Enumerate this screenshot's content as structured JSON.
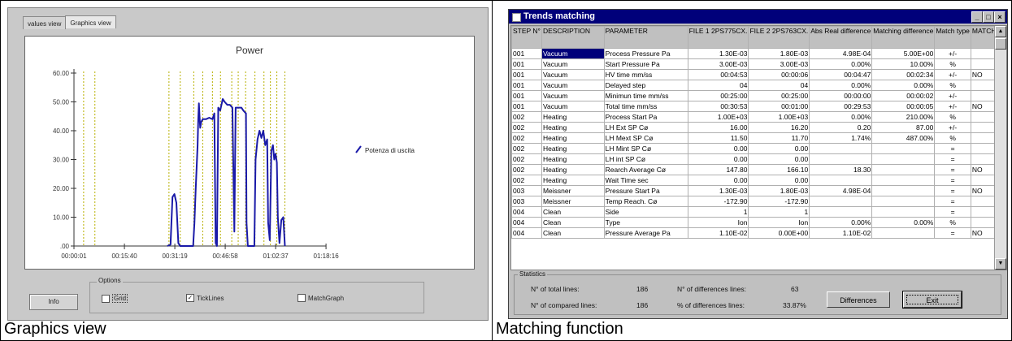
{
  "left": {
    "caption": "Graphics view",
    "tabs": [
      "values view",
      "Graphics view"
    ],
    "options_label": "Options",
    "opt_grid": "Grid",
    "opt_ticklines": "TickLines",
    "opt_matchgraph": "MatchGraph",
    "info_label": "Info"
  },
  "chart_data": {
    "type": "line",
    "title": "Power",
    "xlabel": "",
    "ylabel": "",
    "ylim": [
      0,
      60
    ],
    "y_ticks": [
      "60.00",
      "50.00",
      "40.00",
      "30.00",
      "20.00",
      "10.00",
      ".00"
    ],
    "x_ticks": [
      "00:00:01",
      "00:15:40",
      "00:31:19",
      "00:46:58",
      "01:02:37",
      "01:18:16"
    ],
    "x_range_minutes": [
      0,
      78.25
    ],
    "legend": "top-right",
    "series": [
      {
        "name": "Potenza di uscita",
        "color": "#1a1aa8",
        "points": [
          [
            29.0,
            0
          ],
          [
            30.0,
            0.5
          ],
          [
            30.6,
            17
          ],
          [
            31.2,
            18
          ],
          [
            31.8,
            15
          ],
          [
            32.4,
            1
          ],
          [
            33.0,
            0
          ],
          [
            37.0,
            0
          ],
          [
            37.4,
            8
          ],
          [
            37.8,
            20
          ],
          [
            38.4,
            35
          ],
          [
            38.6,
            44
          ],
          [
            38.8,
            49.5
          ],
          [
            39.0,
            45
          ],
          [
            39.2,
            41
          ],
          [
            39.5,
            43
          ],
          [
            40.0,
            44
          ],
          [
            41.0,
            44
          ],
          [
            42.0,
            44.5
          ],
          [
            43.0,
            44
          ],
          [
            43.6,
            46
          ],
          [
            44.0,
            1
          ],
          [
            44.4,
            0
          ],
          [
            44.8,
            48
          ],
          [
            45.4,
            47
          ],
          [
            46.2,
            51
          ],
          [
            46.8,
            50
          ],
          [
            47.6,
            49
          ],
          [
            48.4,
            49
          ],
          [
            49.2,
            48
          ],
          [
            49.8,
            5
          ],
          [
            50.2,
            48
          ],
          [
            52.0,
            48
          ],
          [
            52.6,
            47
          ],
          [
            53.4,
            46
          ],
          [
            53.6,
            8
          ],
          [
            54.0,
            0
          ],
          [
            56.0,
            0
          ],
          [
            56.4,
            30
          ],
          [
            57.0,
            37
          ],
          [
            57.6,
            40
          ],
          [
            58.2,
            37.5
          ],
          [
            58.8,
            40
          ],
          [
            59.4,
            35
          ],
          [
            60.0,
            37
          ],
          [
            60.3,
            8
          ],
          [
            60.8,
            2
          ],
          [
            61.3,
            33
          ],
          [
            61.8,
            35
          ],
          [
            62.2,
            30
          ],
          [
            62.6,
            32
          ],
          [
            63.0,
            29
          ],
          [
            63.3,
            10
          ],
          [
            63.8,
            1
          ],
          [
            64.4,
            9
          ],
          [
            65.0,
            10
          ],
          [
            65.5,
            0
          ]
        ]
      }
    ],
    "tick_lines_minutes": [
      3.0,
      6.5,
      29.5,
      33.0,
      37.2,
      40.0,
      43.0,
      45.5,
      49.0,
      51.0,
      53.3,
      56.2,
      59.0,
      61.0,
      63.0,
      65.5
    ]
  },
  "right": {
    "caption": "Matching function",
    "window_title": "Trends matching",
    "columns": [
      "STEP N°",
      "DESCRIPTION",
      "PARAMETER",
      "FILE 1 2PS775CX.",
      "FILE 2 2PS763CX.",
      "Abs Real difference",
      "Matching difference",
      "Match type",
      "MATCH?"
    ],
    "rows": [
      [
        "001",
        "Vacuum",
        "Process Pressure Pa",
        "1.30E-03",
        "1.80E-03",
        "4.98E-04",
        "5.00E+00",
        "+/-",
        ""
      ],
      [
        "001",
        "Vacuum",
        "Start Pressure Pa",
        "3.00E-03",
        "3.00E-03",
        "0.00%",
        "10.00%",
        "%",
        ""
      ],
      [
        "001",
        "Vacuum",
        "HV time mm/ss",
        "00:04:53",
        "00:00:06",
        "00:04:47",
        "00:02:34",
        "+/-",
        "NO"
      ],
      [
        "001",
        "Vacuum",
        "Delayed step",
        "04",
        "04",
        "0.00%",
        "0.00%",
        "%",
        ""
      ],
      [
        "001",
        "Vacuum",
        "Minimun time mm/ss",
        "00:25:00",
        "00:25:00",
        "00:00:00",
        "00:00:02",
        "+/-",
        ""
      ],
      [
        "001",
        "Vacuum",
        "Total time mm/ss",
        "00:30:53",
        "00:01:00",
        "00:29:53",
        "00:00:05",
        "+/-",
        "NO"
      ],
      [
        "002",
        "Heating",
        "Process Start Pa",
        "1.00E+03",
        "1.00E+03",
        "0.00%",
        "210.00%",
        "%",
        ""
      ],
      [
        "002",
        "Heating",
        "LH Ext SP Cø",
        "16.00",
        "16.20",
        "0.20",
        "87.00",
        "+/-",
        ""
      ],
      [
        "002",
        "Heating",
        "LH Mext SP Cø",
        "11.50",
        "11.70",
        "1.74%",
        "487.00%",
        "%",
        ""
      ],
      [
        "002",
        "Heating",
        "LH Mint SP Cø",
        "0.00",
        "0.00",
        "",
        "",
        "=",
        ""
      ],
      [
        "002",
        "Heating",
        "LH int SP Cø",
        "0.00",
        "0.00",
        "",
        "",
        "=",
        ""
      ],
      [
        "002",
        "Heating",
        "Rearch Average Cø",
        "147.80",
        "166.10",
        "18.30",
        "",
        "=",
        "NO"
      ],
      [
        "002",
        "Heating",
        "Wait Time sec",
        "0.00",
        "0.00",
        "",
        "",
        "=",
        ""
      ],
      [
        "003",
        "Meissner",
        "Pressure Start Pa",
        "1.30E-03",
        "1.80E-03",
        "4.98E-04",
        "",
        "=",
        "NO"
      ],
      [
        "003",
        "Meissner",
        "Temp Reach. Cø",
        "-172.90",
        "-172.90",
        "",
        "",
        "=",
        ""
      ],
      [
        "004",
        "Clean",
        "Side",
        "1",
        "1",
        "",
        "",
        "=",
        ""
      ],
      [
        "004",
        "Clean",
        "Type",
        "Ion",
        "Ion",
        "0.00%",
        "0.00%",
        "%",
        ""
      ],
      [
        "004",
        "Clean",
        "Pressure Average Pa",
        "1.10E-02",
        "0.00E+00",
        "1.10E-02",
        "",
        "=",
        "NO"
      ]
    ],
    "stats_label": "Statistics",
    "total_lines_label": "N° of total lines:",
    "total_lines": "186",
    "diff_lines_label": "N° of differences lines:",
    "diff_lines": "63",
    "compared_lines_label": "N° of compared lines:",
    "compared_lines": "186",
    "pct_diff_label": "% of differences lines:",
    "pct_diff": "33.87%",
    "differences_btn": "Differences",
    "exit_btn": "Exit",
    "window_buttons": [
      "_",
      "□",
      "×"
    ]
  }
}
